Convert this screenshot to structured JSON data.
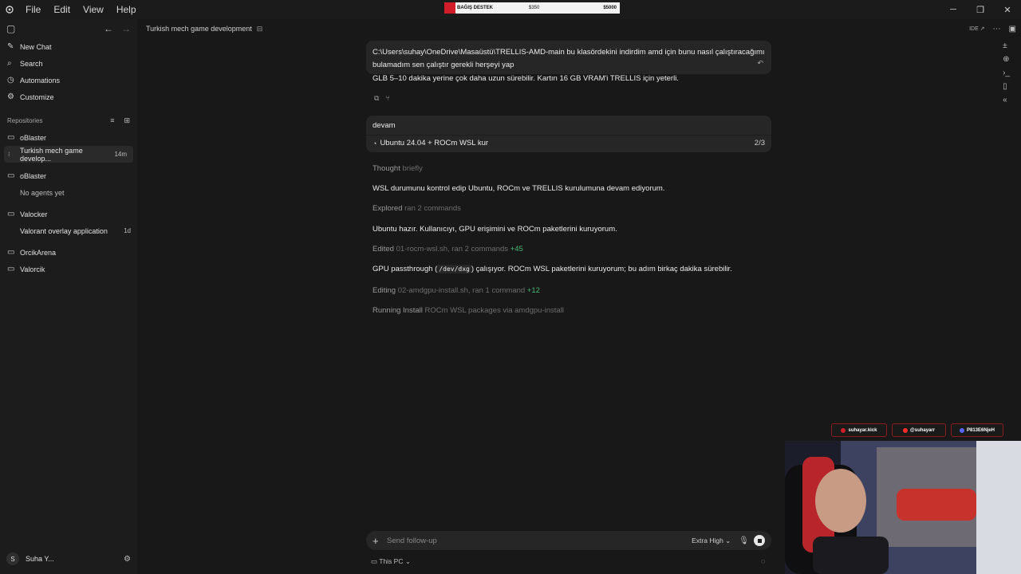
{
  "menu": {
    "items": [
      "File",
      "Edit",
      "View",
      "Help"
    ]
  },
  "donation": {
    "label": "BAĞIŞ DESTEK",
    "current": "$350",
    "goal": "$5000"
  },
  "sidebar": {
    "nav": [
      {
        "label": "New Chat",
        "icon": "pencil-icon"
      },
      {
        "label": "Search",
        "icon": "search-icon"
      },
      {
        "label": "Automations",
        "icon": "clock-icon"
      },
      {
        "label": "Customize",
        "icon": "sliders-icon"
      }
    ],
    "section_title": "Repositories",
    "repos": {
      "r1": {
        "name": "oBlaster",
        "chat": "Turkish mech game develop...",
        "chat_time": "14m"
      },
      "r2": {
        "name": "oBlaster",
        "empty": "No agents yet"
      },
      "r3": {
        "name": "Valocker",
        "chat": "Valorant overlay application",
        "chat_time": "1d"
      },
      "r4": {
        "name": "OrcikArena"
      },
      "r5": {
        "name": "Valorcik"
      }
    },
    "user": {
      "initial": "S",
      "name": "Suha Y..."
    }
  },
  "header": {
    "title": "Turkish mech game development",
    "ide_label": "IDE ↗"
  },
  "conversation": {
    "user_msg_1": "C:\\Users\\suhay\\OneDrive\\Masaüstü\\TRELLIS-AMD-main bu klasördekini indirdim amd için bunu nasıl çalıştıracağımı bulamadım sen çalıştır gerekli herşeyi yap",
    "reply_tail": "GLB 5–10 dakika yerine çok daha uzun sürebilir. Kartın 16 GB VRAM'i TRELLIS için yeterli.",
    "user_msg_2": "devam",
    "todo": {
      "label": "Ubuntu 24.04 + ROCm WSL kur",
      "count": "2/3"
    },
    "thought": {
      "label": "Thought",
      "detail": "briefly"
    },
    "p1": "WSL durumunu kontrol edip Ubuntu, ROCm ve TRELLIS kurulumuna devam ediyorum.",
    "explored": {
      "label": "Explored",
      "detail": "ran 2 commands"
    },
    "p2": "Ubuntu hazır. Kullanıcıyı, GPU erişimini ve ROCm paketlerini kuruyorum.",
    "edited": {
      "label": "Edited",
      "detail": "01-rocm-wsl.sh, ran 2 commands",
      "diff": "+45"
    },
    "p3_pre": "GPU passthrough (",
    "p3_code": "/dev/dxg",
    "p3_post": ") çalışıyor. ROCm WSL paketlerini kuruyorum; bu adım birkaç dakika sürebilir.",
    "editing": {
      "label": "Editing",
      "detail": "02-amdgpu-install.sh, ran 1 command",
      "diff": "+12"
    },
    "running": {
      "label": "Running",
      "detail": "Install",
      "detail2": "ROCm WSL packages via amdgpu-install"
    }
  },
  "composer": {
    "placeholder": "Send follow-up",
    "effort": "Extra High",
    "env": "This PC"
  },
  "overlay": {
    "kick": "suhayar.kick",
    "youtube": "@suhayarr",
    "discord": "P813E6NjeH"
  },
  "colors": {
    "accent_green": "#48b774",
    "overlay_red": "#d11c2a"
  }
}
